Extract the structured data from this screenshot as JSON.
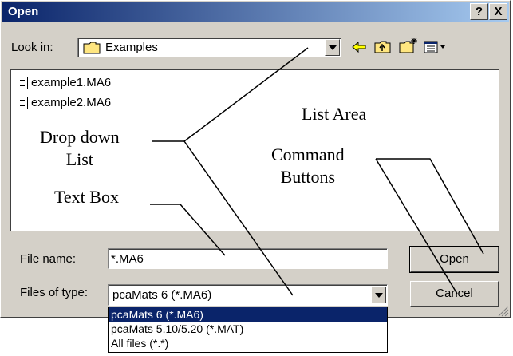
{
  "window": {
    "title": "Open",
    "help_label": "?",
    "close_label": "X"
  },
  "toolbar": {
    "look_in_label": "Look in:",
    "look_in_value": "Examples",
    "icons": [
      "back-arrow-icon",
      "up-folder-icon",
      "new-folder-icon",
      "view-menu-icon"
    ]
  },
  "files": [
    {
      "name": "example1.MA6"
    },
    {
      "name": "example2.MA6"
    }
  ],
  "form": {
    "file_name_label": "File name:",
    "file_name_value": "*.MA6",
    "files_of_type_label": "Files of type:",
    "files_of_type_value": "pcaMats 6 (*.MA6)",
    "type_options": [
      "pcaMats 6 (*.MA6)",
      "pcaMats 5.10/5.20 (*.MAT)",
      "All files (*.*)"
    ]
  },
  "buttons": {
    "open": "Open",
    "cancel": "Cancel"
  },
  "annotations": {
    "drop_down_list": "Drop down\nList",
    "list_area": "List Area",
    "command_buttons": "Command\nButtons",
    "text_box": "Text Box"
  },
  "colors": {
    "title_bar": "#0a246a",
    "dialog_bg": "#d4d0c8",
    "selection": "#0a246a"
  }
}
